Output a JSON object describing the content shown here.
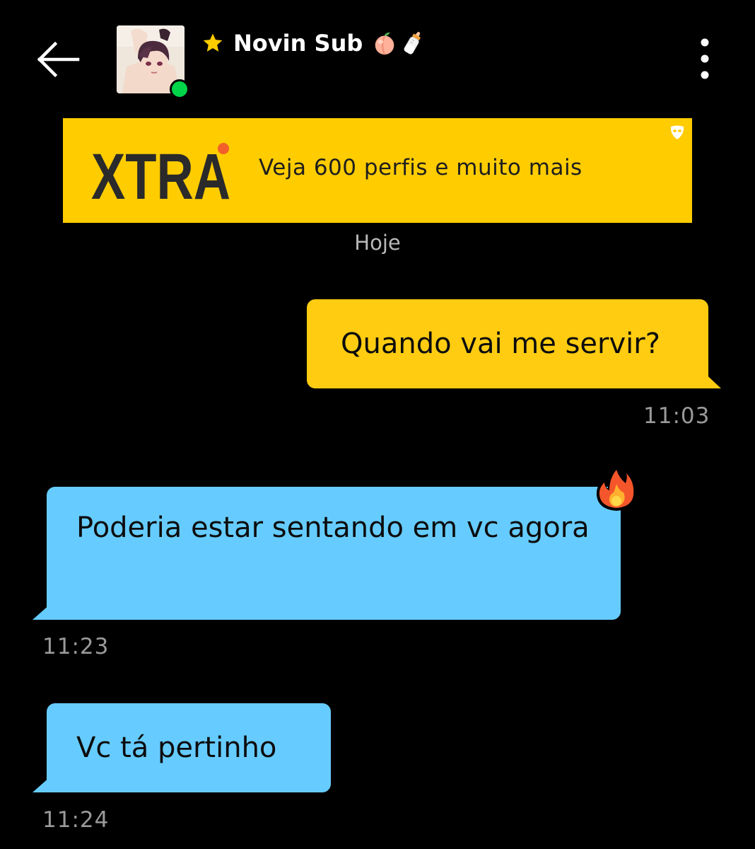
{
  "header": {
    "profile_name": "Novin Sub",
    "favorite_icon": "star-icon",
    "name_emojis": [
      "peach-icon",
      "baby-bottle-icon"
    ],
    "back_icon": "arrow-left-icon",
    "menu_icon": "more-vertical-icon",
    "online_status_color": "#00d449"
  },
  "banner": {
    "logo": "XTRA",
    "text": "Veja 600 perfis e muito mais",
    "background": "#ffcc00"
  },
  "chat": {
    "date_separator": "Hoje",
    "messages": [
      {
        "direction": "outgoing",
        "text": "Quando vai me servir?",
        "time": "11:03",
        "color": "#ffcc11"
      },
      {
        "direction": "incoming",
        "text": "Poderia estar sentando em vc agora",
        "time": "11:23",
        "reaction": "fire-icon",
        "color": "#66ccff"
      },
      {
        "direction": "incoming",
        "text": "Vc tá pertinho",
        "time": "11:24",
        "color": "#66ccff"
      }
    ]
  }
}
